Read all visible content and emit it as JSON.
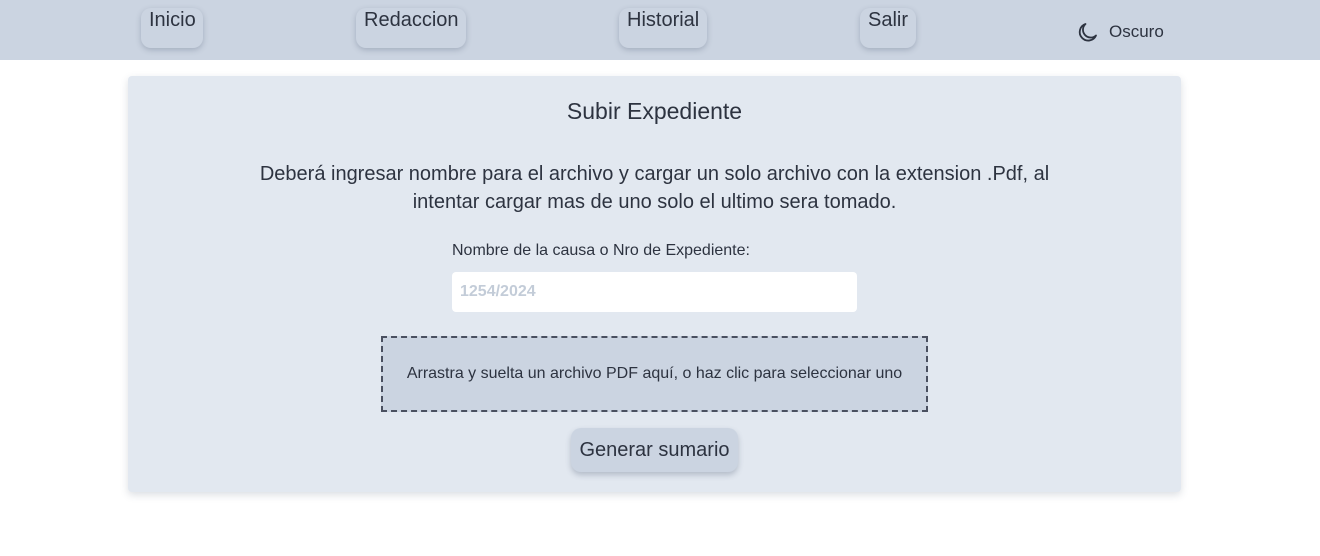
{
  "nav": {
    "items": [
      {
        "label": "Inicio"
      },
      {
        "label": "Redaccion"
      },
      {
        "label": "Historial"
      },
      {
        "label": "Salir"
      }
    ],
    "theme_toggle": {
      "icon": "moon-icon",
      "label": "Oscuro"
    }
  },
  "card": {
    "title": "Subir Expediente",
    "instructions": "Deberá ingresar nombre para el archivo y cargar un solo archivo con la extension .Pdf, al intentar cargar mas de uno solo el ultimo sera tomado.",
    "field_label": "Nombre de la causa o Nro de Expediente:",
    "field_value": "",
    "field_placeholder": "1254/2024",
    "dropzone_text": "Arrastra y suelta un archivo PDF aquí, o haz clic para seleccionar uno",
    "submit_label": "Generar sumario"
  },
  "colors": {
    "topbar": "#cbd4e1",
    "card_bg": "#e2e8f0",
    "text": "#2d3340",
    "placeholder": "#c3ccd8"
  }
}
